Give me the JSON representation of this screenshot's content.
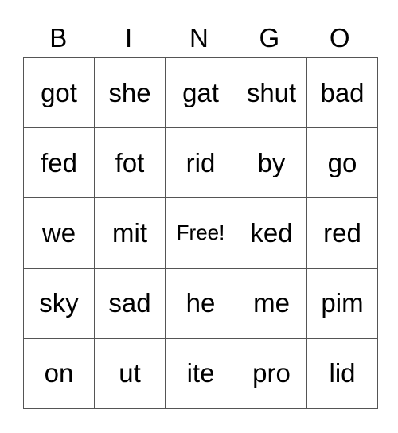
{
  "header": [
    "B",
    "I",
    "N",
    "G",
    "O"
  ],
  "rows": [
    [
      "got",
      "she",
      "gat",
      "shut",
      "bad"
    ],
    [
      "fed",
      "fot",
      "rid",
      "by",
      "go"
    ],
    [
      "we",
      "mit",
      "Free!",
      "ked",
      "red"
    ],
    [
      "sky",
      "sad",
      "he",
      "me",
      "pim"
    ],
    [
      "on",
      "ut",
      "ite",
      "pro",
      "lid"
    ]
  ]
}
